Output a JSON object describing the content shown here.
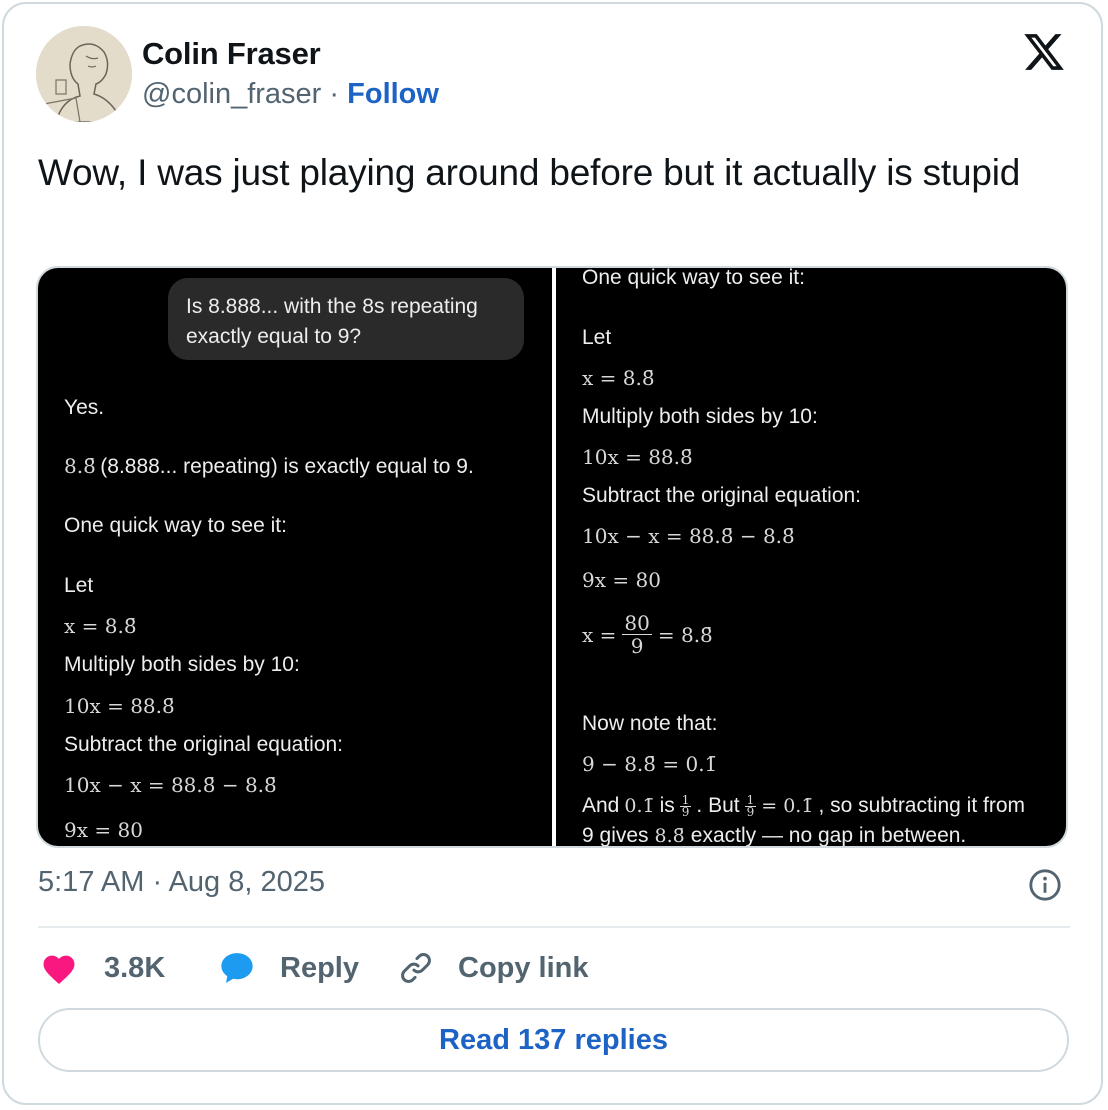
{
  "author": {
    "name": "Colin Fraser",
    "handle": "@colin_fraser",
    "separator": "·",
    "follow_label": "Follow"
  },
  "tweet": {
    "text": "Wow, I was just playing around before but it actually is stupid"
  },
  "media": {
    "left": {
      "question": "Is 8.888... with the 8s repeating exactly equal to 9?",
      "yes": "Yes.",
      "claim_math": "8.8̄",
      "claim_text": "(8.888... repeating) is exactly equal to 9.",
      "quick": "One quick way to see it:",
      "let": "Let",
      "eq1": "x = 8.8̄",
      "mult": "Multiply both sides by 10:",
      "eq2": "10x = 88.8̄",
      "sub": "Subtract the original equation:",
      "eq3": "10x − x = 88.8̄ − 8.8̄",
      "eq4": "9x = 80"
    },
    "right": {
      "quick": "One quick way to see it:",
      "let": "Let",
      "eq1": "x = 8.8̄",
      "mult": "Multiply both sides by 10:",
      "eq2": "10x = 88.8̄",
      "sub": "Subtract the original equation:",
      "eq3": "10x − x = 88.8̄ − 8.8̄",
      "eq4": "9x = 80",
      "eq5_lhs": "x =",
      "eq5_num": "80",
      "eq5_den": "9",
      "eq5_rhs": "= 8.8̄",
      "note": "Now note that:",
      "eq6": "9 − 8.8̄ = 0.1̄",
      "and_1": "And",
      "and_m1": "0.1̄",
      "and_2": "is",
      "and_num": "1",
      "and_den": "9",
      "and_3": ". But",
      "and_m2": "= 0.1̄",
      "and_4": ", so subtracting it from",
      "last_1": "9 gives",
      "last_m": "8.8̄",
      "last_2": "exactly — no gap in between."
    }
  },
  "meta": {
    "timestamp": "5:17 AM · Aug 8, 2025"
  },
  "actions": {
    "likes": "3.8K",
    "reply_label": "Reply",
    "copy_label": "Copy link",
    "read_replies_label": "Read 137 replies"
  },
  "colors": {
    "link_blue": "#1d63c6",
    "like_pink": "#f91880",
    "reply_blue": "#1d9bf0",
    "muted": "#536471"
  },
  "icons": [
    "x-logo-icon",
    "heart-icon",
    "speech-bubble-icon",
    "link-icon",
    "info-icon"
  ]
}
